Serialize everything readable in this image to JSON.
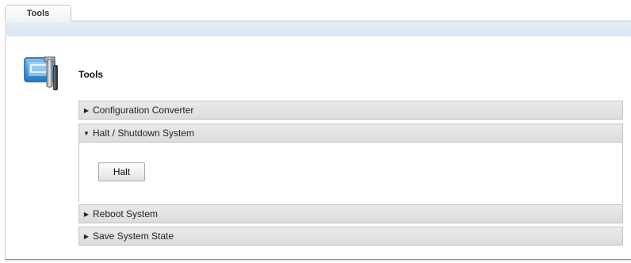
{
  "tabs": [
    {
      "label": "Tools",
      "active": true
    }
  ],
  "page": {
    "title": "Tools",
    "icon": "tools-icon"
  },
  "accordion": {
    "sections": [
      {
        "label": "Configuration Converter",
        "expanded": false
      },
      {
        "label": "Halt / Shutdown System",
        "expanded": true,
        "button_label": "Halt"
      },
      {
        "label": "Reboot System",
        "expanded": false
      },
      {
        "label": "Save System State",
        "expanded": false
      }
    ]
  },
  "colors": {
    "tab_band": "#dbe6f1",
    "section_header": "#e2e2e2",
    "border": "#c4c4c4"
  }
}
